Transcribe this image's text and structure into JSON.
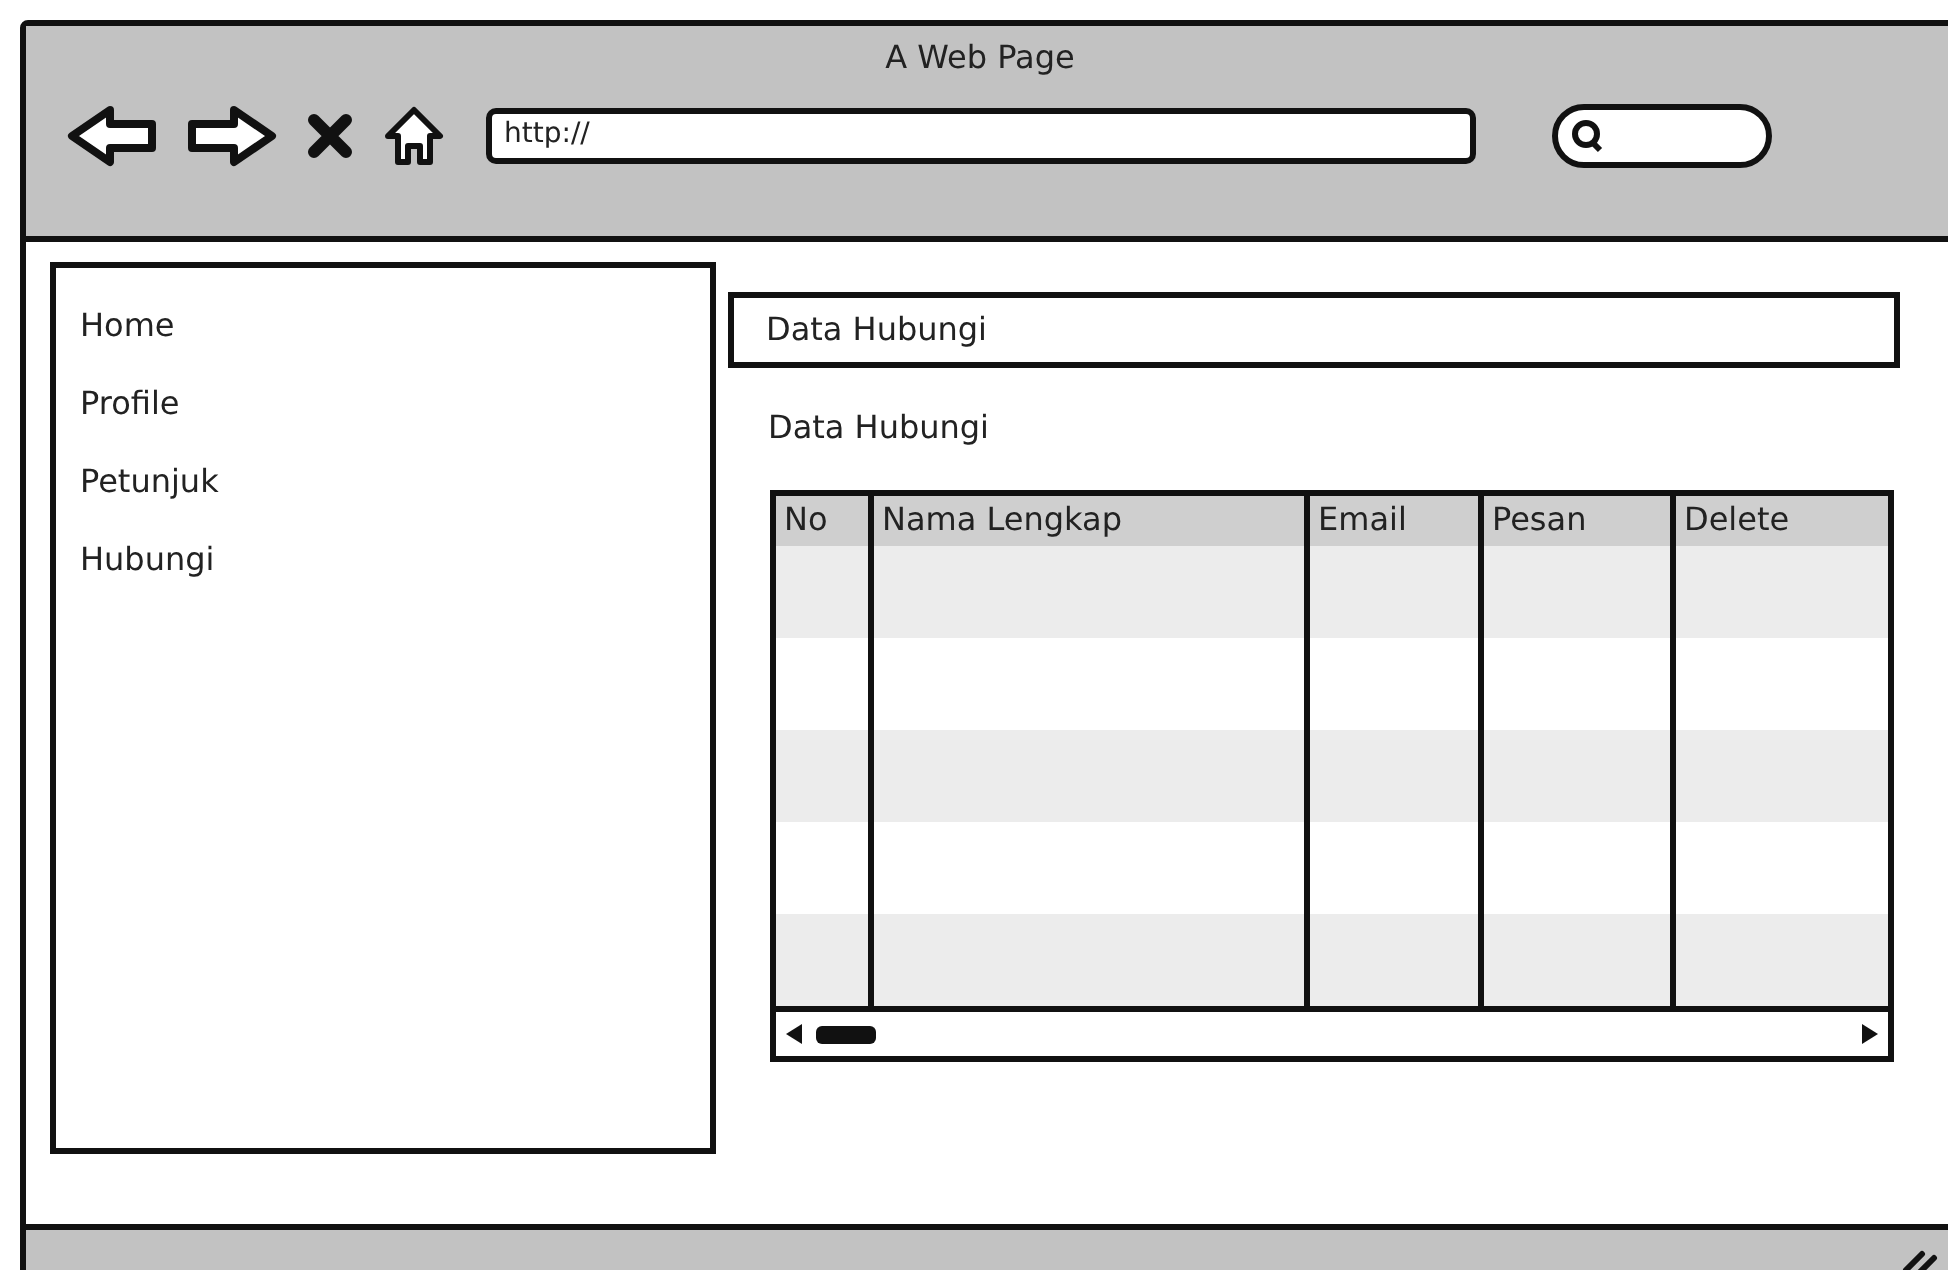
{
  "window": {
    "title": "A Web Page"
  },
  "address_bar": {
    "value": "http://"
  },
  "sidebar": {
    "items": [
      {
        "label": "Home"
      },
      {
        "label": "Profile"
      },
      {
        "label": "Petunjuk"
      },
      {
        "label": "Hubungi"
      }
    ]
  },
  "content": {
    "header": "Data Hubungi",
    "subtitle": "Data Hubungi",
    "table": {
      "columns": [
        "No",
        "Nama Lengkap",
        "Email",
        "Pesan",
        "Delete"
      ]
    }
  }
}
